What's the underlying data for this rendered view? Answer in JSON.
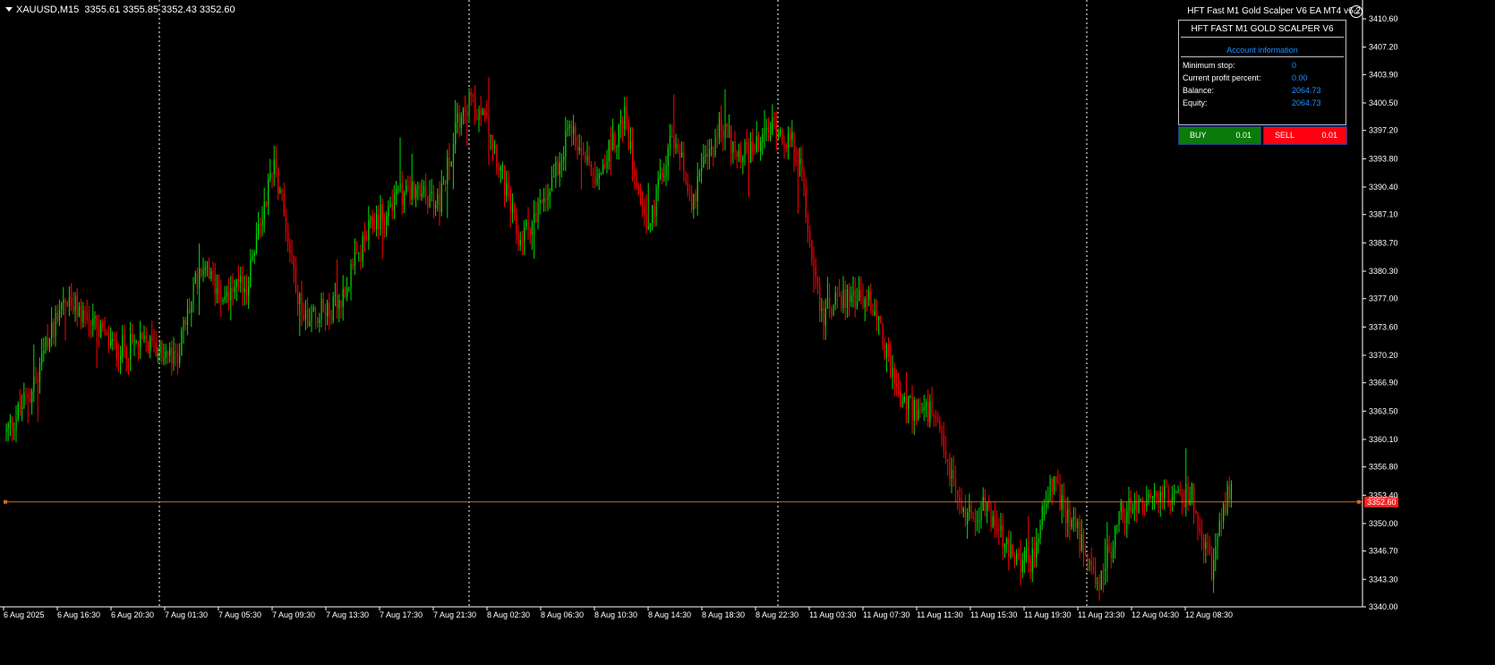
{
  "symbol_line": {
    "symbol": "XAUUSD,M15",
    "ohlc": "3355.61 3355.85 3352.43 3352.60"
  },
  "ea": {
    "title": "HFT Fast M1 Gold Scalper V6 EA MT4 v6.2",
    "smiley": "☺",
    "panel_title": "HFT FAST M1 GOLD SCALPER V6",
    "section": "Account information",
    "rows": [
      {
        "label": "Minimum stop:",
        "value": "0"
      },
      {
        "label": "Current profit percent:",
        "value": "0.00"
      },
      {
        "label": "Balance:",
        "value": "2064.73"
      },
      {
        "label": "Equity:",
        "value": "2064.73"
      }
    ],
    "buy": {
      "label": "BUY",
      "lot": "0.01"
    },
    "sell": {
      "label": "SELL",
      "lot": "0.01"
    }
  },
  "colors": {
    "bull": "#00dd00",
    "bear": "#ff0000",
    "grid": "#ffffff",
    "price_line": "#d2691e",
    "price_tag": "#ff2020",
    "axis_text": "#ffffff"
  },
  "chart_data": {
    "type": "candlestick",
    "timeframe": "M15",
    "ylim": [
      3340.0,
      3412.0
    ],
    "y_ticks": [
      "3410.60",
      "3407.20",
      "3403.90",
      "3400.50",
      "3397.20",
      "3393.80",
      "3390.40",
      "3387.10",
      "3383.70",
      "3380.30",
      "3377.00",
      "3373.60",
      "3370.20",
      "3366.90",
      "3363.50",
      "3360.10",
      "3356.80",
      "3353.40",
      "3350.00",
      "3346.70",
      "3343.30",
      "3340.00"
    ],
    "x_ticks": [
      "6 Aug 2025",
      "6 Aug 16:30",
      "6 Aug 20:30",
      "7 Aug 01:30",
      "7 Aug 05:30",
      "7 Aug 09:30",
      "7 Aug 13:30",
      "7 Aug 17:30",
      "7 Aug 21:30",
      "8 Aug 02:30",
      "8 Aug 06:30",
      "8 Aug 10:30",
      "8 Aug 14:30",
      "8 Aug 18:30",
      "8 Aug 22:30",
      "11 Aug 03:30",
      "11 Aug 07:30",
      "11 Aug 11:30",
      "11 Aug 15:30",
      "11 Aug 19:30",
      "11 Aug 23:30",
      "12 Aug 04:30",
      "12 Aug 08:30"
    ],
    "current_price": 3352.6,
    "current_price_label": "3352.60",
    "day_separators": [
      "6 Aug",
      "7 Aug",
      "8 Aug",
      "11 Aug"
    ],
    "path_low": 3341.5,
    "path_high": 3408.5,
    "path": [
      {
        "bar": 0,
        "price": 3361.0
      },
      {
        "bar": 14,
        "price": 3366.5
      },
      {
        "bar": 28,
        "price": 3377.0
      },
      {
        "bar": 40,
        "price": 3375.0
      },
      {
        "bar": 55,
        "price": 3371.0
      },
      {
        "bar": 72,
        "price": 3371.5
      },
      {
        "bar": 86,
        "price": 3369.5
      },
      {
        "bar": 98,
        "price": 3380.5
      },
      {
        "bar": 112,
        "price": 3377.5
      },
      {
        "bar": 122,
        "price": 3378.5
      },
      {
        "bar": 136,
        "price": 3394.0
      },
      {
        "bar": 150,
        "price": 3375.0
      },
      {
        "bar": 168,
        "price": 3376.0
      },
      {
        "bar": 186,
        "price": 3386.0
      },
      {
        "bar": 202,
        "price": 3390.0
      },
      {
        "bar": 220,
        "price": 3388.5
      },
      {
        "bar": 232,
        "price": 3401.0
      },
      {
        "bar": 245,
        "price": 3398.0
      },
      {
        "bar": 260,
        "price": 3384.0
      },
      {
        "bar": 272,
        "price": 3388.0
      },
      {
        "bar": 286,
        "price": 3397.5
      },
      {
        "bar": 300,
        "price": 3392.0
      },
      {
        "bar": 314,
        "price": 3398.5
      },
      {
        "bar": 326,
        "price": 3385.0
      },
      {
        "bar": 338,
        "price": 3397.0
      },
      {
        "bar": 348,
        "price": 3389.0
      },
      {
        "bar": 362,
        "price": 3397.5
      },
      {
        "bar": 376,
        "price": 3394.0
      },
      {
        "bar": 390,
        "price": 3398.0
      },
      {
        "bar": 402,
        "price": 3394.5
      },
      {
        "bar": 414,
        "price": 3375.0
      },
      {
        "bar": 428,
        "price": 3377.5
      },
      {
        "bar": 440,
        "price": 3376.5
      },
      {
        "bar": 454,
        "price": 3364.5
      },
      {
        "bar": 470,
        "price": 3363.0
      },
      {
        "bar": 486,
        "price": 3351.0
      },
      {
        "bar": 498,
        "price": 3352.0
      },
      {
        "bar": 510,
        "price": 3346.0
      },
      {
        "bar": 520,
        "price": 3345.5
      },
      {
        "bar": 530,
        "price": 3355.0
      },
      {
        "bar": 542,
        "price": 3350.0
      },
      {
        "bar": 554,
        "price": 3342.5
      },
      {
        "bar": 566,
        "price": 3351.0
      },
      {
        "bar": 578,
        "price": 3353.0
      },
      {
        "bar": 590,
        "price": 3353.0
      },
      {
        "bar": 602,
        "price": 3353.5
      },
      {
        "bar": 612,
        "price": 3344.5
      },
      {
        "bar": 622,
        "price": 3355.5
      }
    ]
  }
}
